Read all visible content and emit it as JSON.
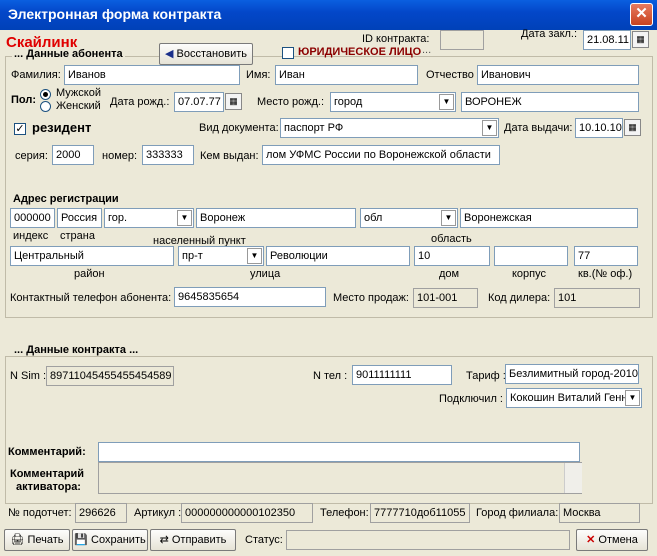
{
  "window": {
    "title": "Электронная форма контракта",
    "close_glyph": "✕"
  },
  "header": {
    "operator": "Скайлинк",
    "contract_id_label": "ID контракта:",
    "contract_id_value": "",
    "date_label": "Дата закл.:",
    "date_value": "21.08.11"
  },
  "subscriber": {
    "legend": "Данные абонента",
    "restore_label": "Восстановить",
    "legal_entity_label": "ЮРИДИЧЕСКОЕ ЛИЦО",
    "surname_label": "Фамилия:",
    "surname": "Иванов",
    "name_label": "Имя:",
    "name": "Иван",
    "patronymic_label": "Отчество",
    "patronymic": "Иванович",
    "gender_label": "Пол:",
    "male": "Мужской",
    "female": "Женский",
    "birth_label": "Дата рожд.:",
    "birth": "07.07.77",
    "birthplace_label": "Место рожд.:",
    "birthplace_type": "город",
    "birthplace": "ВОРОНЕЖ",
    "resident_label": "резидент",
    "doctype_label": "Вид документа:",
    "doctype": "паспорт РФ",
    "issue_label": "Дата выдачи:",
    "issue": "10.10.10",
    "series_label": "серия:",
    "series": "2000",
    "number_label": "номер:",
    "number": "333333",
    "issuer_label": "Кем выдан:",
    "issuer": "лом УФМС России по Воронежской области"
  },
  "address": {
    "title": "Адрес регистрации",
    "index": "000000",
    "country": "Россия",
    "settlement_type": "гор.",
    "settlement": "Воронеж",
    "region_type": "обл",
    "region": "Воронежская",
    "index_label": "индекс",
    "country_label": "страна",
    "settlement_label": "населенный пункт",
    "region_label": "область",
    "district": "Центральный",
    "street_type": "пр-т",
    "street": "Революции",
    "house": "10",
    "building": "",
    "apartment": "77",
    "district_label": "район",
    "street_label": "улица",
    "house_label": "дом",
    "building_label": "корпус",
    "apartment_label": "кв.(№ оф.)",
    "phone_label": "Контактный телефон абонента:",
    "phone": "9645835654",
    "sale_place_label": "Место продаж:",
    "sale_place": "101-001",
    "dealer_label": "Код дилера:",
    "dealer": "101"
  },
  "contract": {
    "legend": "Данные контракта",
    "sim_label": "N Sim :",
    "sim": "89711045455455454589",
    "phone_label": "N тел :",
    "phone": "9011111111",
    "tariff_label": "Тариф :",
    "tariff": "Безлимитный город-2010",
    "connected_by_label": "Подключил :",
    "connected_by": "Кокошин Виталий Генн",
    "comment_label": "Комментарий:",
    "comment": "",
    "activator_comment_label_1": "Комментарий",
    "activator_comment_label_2": "активатора:",
    "activator_comment": ""
  },
  "footer": {
    "report_label": "№ подотчет:",
    "report": "296626",
    "article_label": "Артикул :",
    "article": "000000000000102350",
    "phone_label": "Телефон:",
    "phone": "7777710доб11055",
    "city_label": "Город филиала:",
    "city": "Москва"
  },
  "toolbar": {
    "print": "Печать",
    "save": "Сохранить",
    "send": "Отправить",
    "status_label": "Статус:",
    "status": "",
    "cancel": "Отмена"
  },
  "colors": {
    "operator": "#e00000",
    "legal": "#8b0000",
    "titlebar": "#0347c9"
  }
}
